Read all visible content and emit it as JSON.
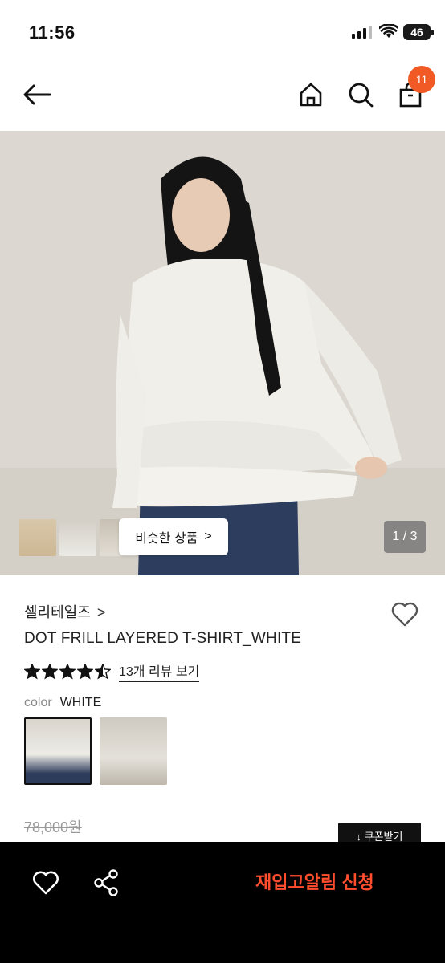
{
  "status": {
    "time": "11:56",
    "battery": "46"
  },
  "nav": {
    "cart_count": "11"
  },
  "hero": {
    "similar_label": "비슷한 상품",
    "similar_chevron": ">",
    "counter": "1 / 3"
  },
  "product": {
    "brand": "셀리테일즈",
    "brand_chevron": ">",
    "name": "DOT FRILL LAYERED T-SHIRT_WHITE",
    "rating": 4.5,
    "review_link": "13개 리뷰 보기",
    "color_label": "color",
    "color_value": "WHITE",
    "price_original": "78,000원",
    "coupon_label": "↓ 쿠폰받기"
  },
  "bottom": {
    "restock_label": "재입고알림 신청"
  },
  "colors": {
    "accent": "#f15a24",
    "restock": "#ff4d2e",
    "bottom_bg": "#000000"
  }
}
